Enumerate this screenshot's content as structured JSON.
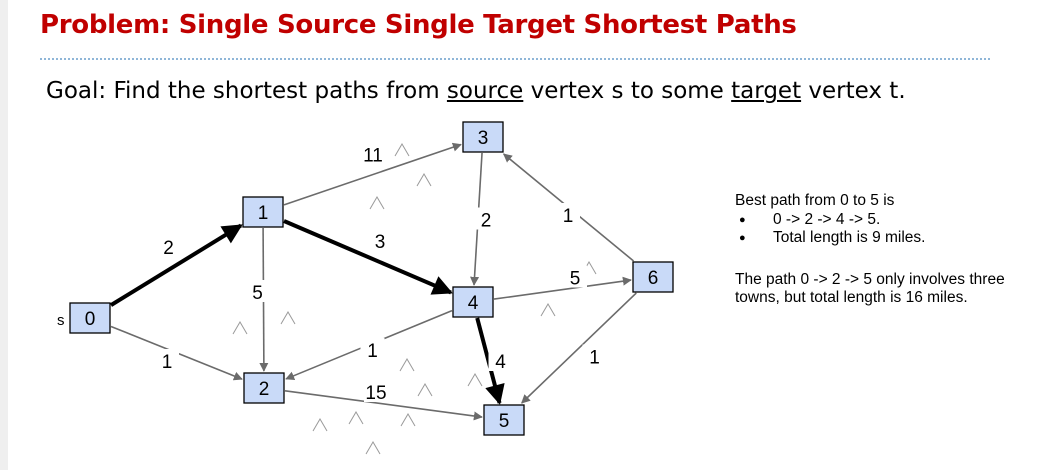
{
  "slide": {
    "title": "Problem: Single Source Single Target Shortest Paths",
    "goal": {
      "prefix": "Goal: Find the shortest paths from ",
      "source_word": "source",
      "middle": " vertex s to some ",
      "target_word": "target",
      "suffix": " vertex t."
    }
  },
  "graph": {
    "source_label": "s",
    "hat_glyph": "^",
    "nodes": [
      {
        "id": "0",
        "label": "0"
      },
      {
        "id": "1",
        "label": "1"
      },
      {
        "id": "2",
        "label": "2"
      },
      {
        "id": "3",
        "label": "3"
      },
      {
        "id": "4",
        "label": "4"
      },
      {
        "id": "5",
        "label": "5"
      },
      {
        "id": "6",
        "label": "6"
      }
    ],
    "edges": [
      {
        "from": "0",
        "to": "1",
        "weight": "2",
        "bold": true
      },
      {
        "from": "0",
        "to": "2",
        "weight": "1",
        "bold": false
      },
      {
        "from": "1",
        "to": "3",
        "weight": "11",
        "bold": false
      },
      {
        "from": "1",
        "to": "4",
        "weight": "3",
        "bold": true
      },
      {
        "from": "1",
        "to": "2",
        "weight": "5",
        "bold": false
      },
      {
        "from": "3",
        "to": "4",
        "weight": "2",
        "bold": false
      },
      {
        "from": "4",
        "to": "2",
        "weight": "1",
        "bold": false
      },
      {
        "from": "4",
        "to": "5",
        "weight": "4",
        "bold": true
      },
      {
        "from": "4",
        "to": "6",
        "weight": "5",
        "bold": false
      },
      {
        "from": "2",
        "to": "5",
        "weight": "15",
        "bold": false
      },
      {
        "from": "6",
        "to": "3",
        "weight": "1",
        "bold": false
      },
      {
        "from": "6",
        "to": "5",
        "weight": "1",
        "bold": false
      }
    ]
  },
  "notes": {
    "best_path_heading": "Best path from 0 to 5 is",
    "bullets": [
      "0 -> 2 -> 4 -> 5.",
      "Total length is 9 miles."
    ],
    "alt_path": "The path 0 -> 2 -> 5 only involves three towns, but total length is 16 miles."
  },
  "colors": {
    "title": "#c00000",
    "node_fill": "#c9daf8",
    "node_stroke": "#000000",
    "edge": "#6b6b6b",
    "bold_edge": "#000000",
    "title_rule": "#8fb6d8"
  }
}
